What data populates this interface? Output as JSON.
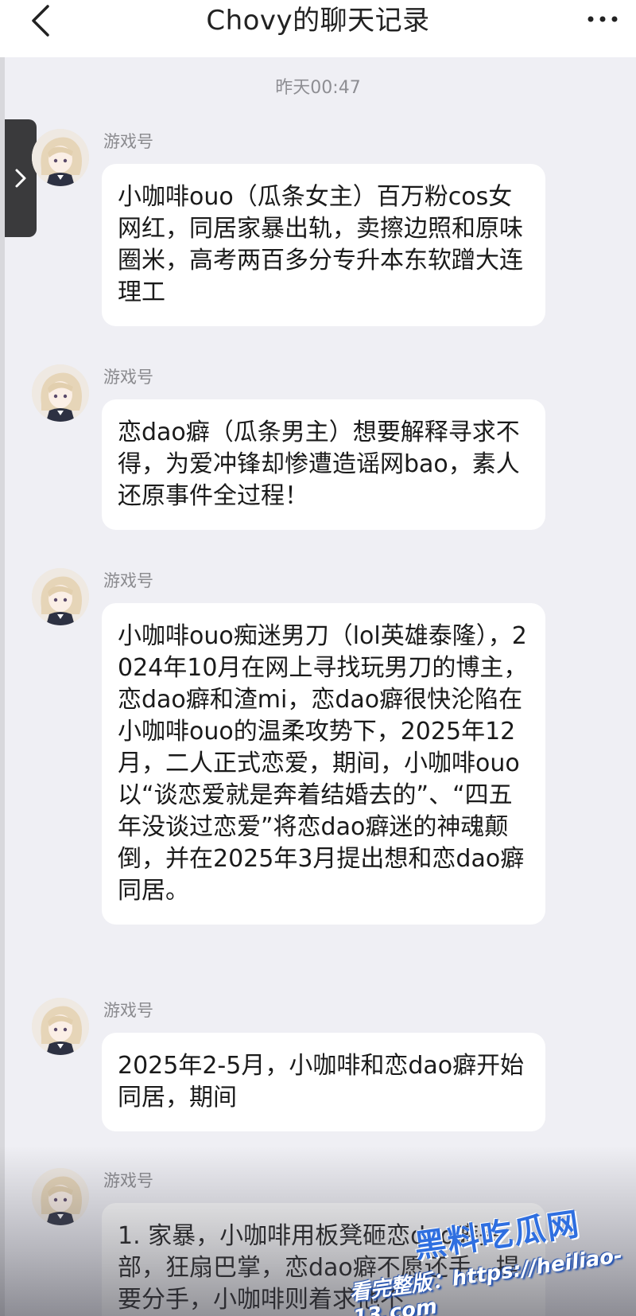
{
  "header": {
    "title": "Chovy的聊天记录"
  },
  "time_divider": "昨天00:47",
  "messages": [
    {
      "sender": "游戏号",
      "text": "小咖啡ouo（瓜条女主）百万粉cos女网红，同居家暴出轨，卖擦边照和原味圈米，高考两百多分专升本东软蹭大连理工"
    },
    {
      "sender": "游戏号",
      "text": "恋dao癖（瓜条男主）想要解释寻求不得，为爱冲锋却惨遭造谣网bao，素人还原事件全过程！"
    },
    {
      "sender": "游戏号",
      "text": "小咖啡ouo痴迷男刀（lol英雄泰隆），2024年10月在网上寻找玩男刀的博主，恋dao癖和渣mi，恋dao癖很快沦陷在小咖啡ouo的温柔攻势下，2025年12月，二人正式恋爱，期间，小咖啡ouo以“谈恋爱就是奔着结婚去的”、“四五年没谈过恋爱”将恋dao癖迷的神魂颠倒，并在2025年3月提出想和恋dao癖同居。"
    },
    {
      "sender": "游戏号",
      "text": "2025年2-5月，小咖啡和恋dao癖开始同居，期间"
    },
    {
      "sender": "游戏号",
      "text": "1. 家暴，小咖啡用板凳砸恋dao癖头部，狂扇巴掌，恋dao癖不愿还手，提要分手，小咖啡则着求他不"
    }
  ],
  "watermark": {
    "brand": "黑料吃瓜网",
    "url": "看完整版：https://heiliao-13.com"
  },
  "icons": {
    "back": "chevron-left-icon",
    "more": "more-dots-icon",
    "side": "chevron-right-icon",
    "avatar": "anime-girl-avatar"
  }
}
